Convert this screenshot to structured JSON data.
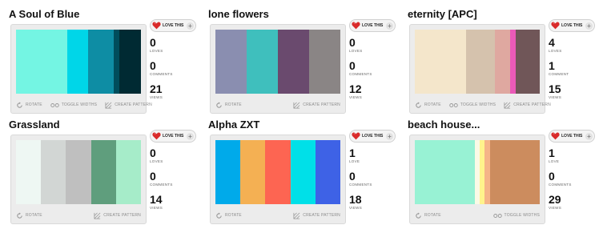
{
  "palettes": [
    {
      "title": "A Soul of Blue",
      "colors": [
        "#74f5e3",
        "#00d6e8",
        "#0e8da4",
        "#004d5c",
        "#002a33"
      ],
      "widths": [
        0.41,
        0.17,
        0.2,
        0.05,
        0.17
      ],
      "love_label": "LOVE THIS",
      "loves": "0",
      "loves_label": "LOVES",
      "comments": "0",
      "comments_label": "COMMENTS",
      "views": "21",
      "views_label": "VIEWS",
      "tools": [
        "ROTATE",
        "TOGGLE WIDTHS",
        "CREATE PATTERN"
      ]
    },
    {
      "title": "lone flowers",
      "colors": [
        "#8a8eb0",
        "#3fbfbd",
        "#6a4a6e",
        "#8a8585"
      ],
      "widths": [
        0.25,
        0.25,
        0.25,
        0.25
      ],
      "love_label": "LOVE THIS",
      "loves": "0",
      "loves_label": "LOVES",
      "comments": "0",
      "comments_label": "COMMENTS",
      "views": "12",
      "views_label": "VIEWS",
      "tools": [
        "ROTATE",
        "CREATE PATTERN"
      ]
    },
    {
      "title": "eternity [APC]",
      "colors": [
        "#f4e6cb",
        "#d5c2ad",
        "#dfa8a0",
        "#ea5ab8",
        "#705658"
      ],
      "widths": [
        0.41,
        0.23,
        0.12,
        0.05,
        0.19
      ],
      "love_label": "LOVE THIS",
      "loves": "4",
      "loves_label": "LOVES",
      "comments": "1",
      "comments_label": "COMMENT",
      "views": "15",
      "views_label": "VIEWS",
      "tools": [
        "ROTATE",
        "TOGGLE WIDTHS",
        "CREATE PATTERN"
      ]
    },
    {
      "title": "Grassland",
      "colors": [
        "#eef7f3",
        "#d2d6d4",
        "#bfbfbf",
        "#5f9e7d",
        "#a6ecc9"
      ],
      "widths": [
        0.2,
        0.2,
        0.2,
        0.2,
        0.2
      ],
      "love_label": "LOVE THIS",
      "loves": "0",
      "loves_label": "LOVES",
      "comments": "0",
      "comments_label": "COMMENTS",
      "views": "14",
      "views_label": "VIEWS",
      "tools": [
        "ROTATE",
        "CREATE PATTERN"
      ]
    },
    {
      "title": "Alpha ZXT",
      "colors": [
        "#00aaea",
        "#f4b053",
        "#fd6552",
        "#00e0e8",
        "#3e62e6"
      ],
      "widths": [
        0.2,
        0.2,
        0.2,
        0.2,
        0.2
      ],
      "love_label": "LOVE THIS",
      "loves": "1",
      "loves_label": "LOVE",
      "comments": "0",
      "comments_label": "COMMENTS",
      "views": "18",
      "views_label": "VIEWS",
      "tools": [
        "ROTATE",
        "CREATE PATTERN"
      ]
    },
    {
      "title": "beach house...",
      "colors": [
        "#98f2d4",
        "#fafae6",
        "#fff38c",
        "#f5b488",
        "#cc8c5e"
      ],
      "widths": [
        0.48,
        0.04,
        0.04,
        0.04,
        0.4
      ],
      "love_label": "LOVE THIS",
      "loves": "1",
      "loves_label": "LOVE",
      "comments": "0",
      "comments_label": "COMMENTS",
      "views": "29",
      "views_label": "VIEWS",
      "tools": [
        "ROTATE",
        "TOGGLE WIDTHS"
      ]
    }
  ]
}
